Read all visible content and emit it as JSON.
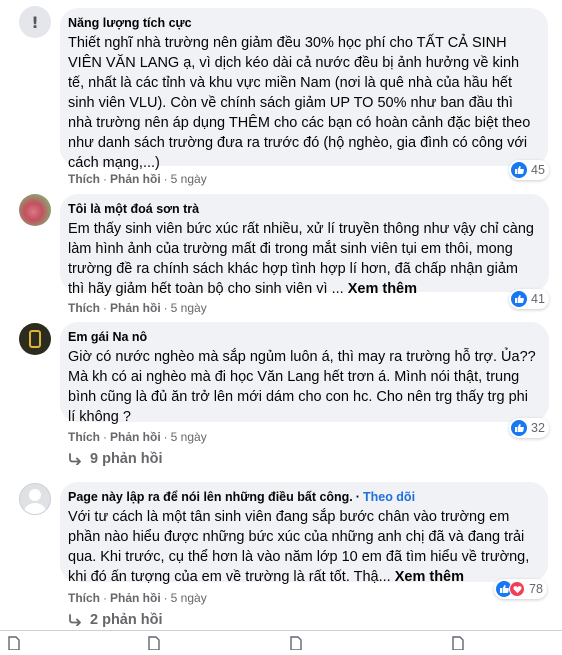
{
  "comments": [
    {
      "author": "Năng lượng tích cực",
      "follow": "",
      "text": "Thiết nghĩ nhà trường nên giảm đều 30% học phí cho TẤT CẢ SINH VIÊN VĂN LANG ạ, vì dịch kéo dài cả nước đều bị ảnh hưởng về kinh tế, nhất là các tỉnh và khu vực miền Nam (nơi là quê nhà của hầu hết sinh viên VLU). Còn về chính sách giảm UP TO 50% như ban đầu thì nhà trường nên áp dụng THÊM cho các bạn có hoàn cảnh đặc biệt theo như danh sách trường đưa ra trước đó (hộ nghèo, gia đình có công với cách mạng,...)",
      "see_more": "",
      "like": "Thích",
      "reply": "Phản hồi",
      "time": "5 ngày",
      "reactions": "45",
      "avatar_icon": "alert-icon"
    },
    {
      "author": "Tôi là một đoá sơn trà",
      "follow": "",
      "text": "Em thấy sinh viên bức xúc rất nhiều, xử lí truyền thông như vậy chỉ càng làm hình ảnh của trường mất đi trong mắt sinh viên tụi em thôi, mong trường đề ra chính sách khác hợp tình hợp lí hơn, đã chấp nhận giảm thì hãy giảm hết toàn bộ cho sinh viên vì ... ",
      "see_more": "Xem thêm",
      "like": "Thích",
      "reply": "Phản hồi",
      "time": "5 ngày",
      "reactions": "41",
      "avatar_icon": "flower-avatar"
    },
    {
      "author": "Em gái Na nô",
      "follow": "",
      "text": "Giờ có nước nghèo mà sắp ngủm luôn á, thì may ra trường hỗ trợ. Ủa?? Mà kh có ai nghèo mà đi học Văn Lang hết trơn á. Mình nói thật, trung bình cũng là đủ ăn trở lên mới dám cho con hc. Cho nên trg thấy trg phi lí không ?",
      "see_more": "",
      "like": "Thích",
      "reply": "Phản hồi",
      "time": "5 ngày",
      "reactions": "32",
      "replies": "9 phản hồi",
      "avatar_icon": "poster-avatar"
    },
    {
      "author": "Page này lập ra để nói lên những điều bất công.",
      "follow": "Theo dõi",
      "text": "Với tư cách là một tân sinh viên đang sắp bước chân vào trường em phần nào hiểu được những bức xúc của những anh chị đã và đang trải qua. Khi trước, cụ thể hơn là vào năm lớp 10 em đã tìm hiểu về trường, khi đó ấn tượng của em về trường là rất tốt. Thậ... ",
      "see_more": "Xem thêm",
      "like": "Thích",
      "reply": "Phản hồi",
      "time": "5 ngày",
      "reactions": "78",
      "replies": "2 phản hồi",
      "avatar_icon": "default-user-avatar"
    }
  ],
  "separator": "·",
  "colors": {
    "like_blue": "#1877f2",
    "love_red": "#f33e58",
    "bubble_bg": "#f0f2f5",
    "meta_gray": "#65676b",
    "follow_blue": "#216fdb"
  }
}
